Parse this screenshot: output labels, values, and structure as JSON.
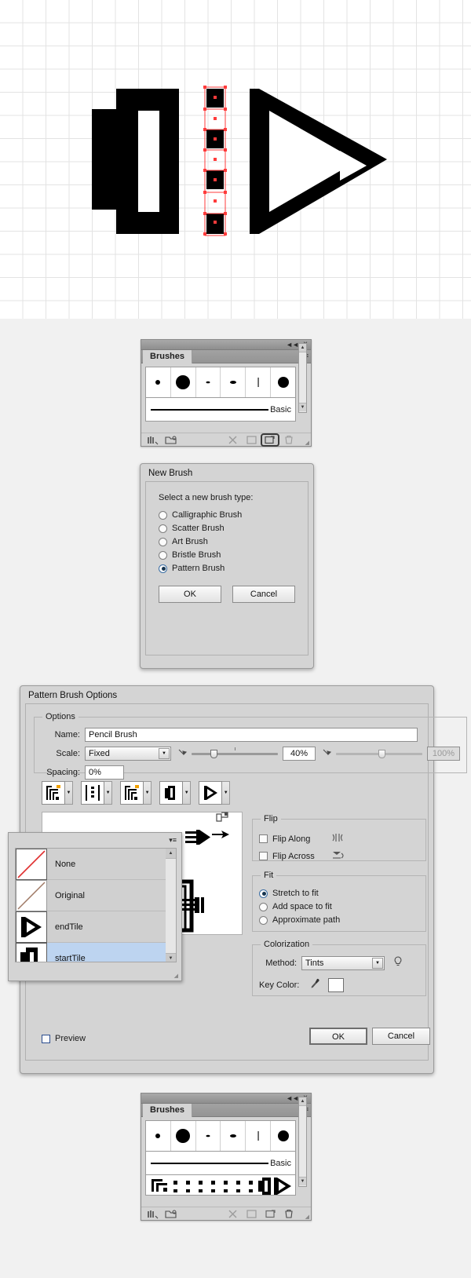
{
  "canvas": {
    "name": "illustrator-artboard",
    "description": "Pencil artwork with selected dashed pattern segment",
    "grid": true
  },
  "brushes_panel_top": {
    "title": "Brushes",
    "tab_label": "Brushes",
    "collapse_icon": "collapse-icon",
    "close_icon": "close-icon",
    "menu_icon": "panel-menu-icon",
    "row_label": "Basic",
    "swatches": [
      "dot-small",
      "dot-large",
      "dot-tiny",
      "dot-oval",
      "stroke-thin",
      "dot-round"
    ],
    "footer_icons": [
      "brush-libraries-icon",
      "libraries-panel-icon",
      "remove-brush-link-icon",
      "options-of-selected-object-icon",
      "new-brush-icon",
      "delete-brush-icon"
    ],
    "selected_footer_icon": "new-brush-icon"
  },
  "new_brush_dialog": {
    "title": "New Brush",
    "prompt": "Select a new brush type:",
    "options": [
      {
        "label": "Calligraphic Brush",
        "selected": false
      },
      {
        "label": "Scatter Brush",
        "selected": false
      },
      {
        "label": "Art Brush",
        "selected": false
      },
      {
        "label": "Bristle Brush",
        "selected": false
      },
      {
        "label": "Pattern Brush",
        "selected": true
      }
    ],
    "ok_label": "OK",
    "cancel_label": "Cancel"
  },
  "pattern_brush_options": {
    "title": "Pattern Brush Options",
    "options_group": {
      "legend": "Options",
      "name_label": "Name:",
      "name_value": "Pencil Brush",
      "scale_label": "Scale:",
      "scale_mode": "Fixed",
      "scale_value": "40%",
      "scale_value_2": "100%",
      "spacing_label": "Spacing:",
      "spacing_value": "0%"
    },
    "tiles": [
      {
        "name": "side-tile",
        "icon": "side-tile-icon"
      },
      {
        "name": "outer-corner-tile",
        "icon": "outer-corner-tile-icon"
      },
      {
        "name": "inner-corner-tile",
        "icon": "inner-corner-tile-icon"
      },
      {
        "name": "start-tile",
        "icon": "start-tile-icon"
      },
      {
        "name": "end-tile",
        "icon": "end-tile-icon"
      }
    ],
    "tile_popup": {
      "menu_icon": "popup-menu-icon",
      "items": [
        {
          "label": "None",
          "swatch": "none-swatch",
          "state": "normal"
        },
        {
          "label": "Original",
          "swatch": "original-swatch",
          "state": "disabled"
        },
        {
          "label": "endTile",
          "swatch": "end-tile-swatch",
          "state": "normal"
        },
        {
          "label": "startTile",
          "swatch": "start-tile-swatch",
          "state": "selected"
        }
      ],
      "scroll_up_icon": "scroll-up-arrow",
      "scroll_down_icon": "scroll-down-arrow",
      "resize_icon": "resize-grip-icon"
    },
    "flip_group": {
      "legend": "Flip",
      "flip_along_label": "Flip Along",
      "flip_along_checked": false,
      "flip_along_icon": "flip-along-icon",
      "flip_across_label": "Flip Across",
      "flip_across_checked": false,
      "flip_across_icon": "flip-across-icon"
    },
    "fit_group": {
      "legend": "Fit",
      "options": [
        {
          "label": "Stretch to fit",
          "selected": true
        },
        {
          "label": "Add space to fit",
          "selected": false
        },
        {
          "label": "Approximate path",
          "selected": false
        }
      ]
    },
    "colorization_group": {
      "legend": "Colorization",
      "method_label": "Method:",
      "method_value": "Tints",
      "tip_icon": "lightbulb-tip-icon",
      "key_color_label": "Key Color:",
      "eyedropper_icon": "eyedropper-icon",
      "key_color_value": "#ffffff"
    },
    "preview_label": "Preview",
    "preview_checked": false,
    "ok_label": "OK",
    "cancel_label": "Cancel"
  },
  "brushes_panel_bottom": {
    "title": "Brushes",
    "tab_label": "Brushes",
    "collapse_icon": "collapse-icon",
    "close_icon": "close-icon",
    "menu_icon": "panel-menu-icon",
    "row_label": "Basic",
    "swatches": [
      "dot-small",
      "dot-large",
      "dot-tiny",
      "dot-oval",
      "stroke-thin",
      "dot-round"
    ],
    "new_brush_preview": "pencil-pattern-brush-preview",
    "footer_icons": [
      "brush-libraries-icon",
      "libraries-panel-icon",
      "remove-brush-link-icon",
      "options-of-selected-object-icon",
      "new-brush-icon",
      "delete-brush-icon"
    ]
  },
  "colors": {
    "panel_bg": "#d4d4d4",
    "page_bg": "#f1f1f1",
    "selection_blue": "#bdd4f0",
    "anchor_red": "#ff3b3b",
    "artwork_black": "#000000",
    "grid_line": "#e3e3e3"
  }
}
